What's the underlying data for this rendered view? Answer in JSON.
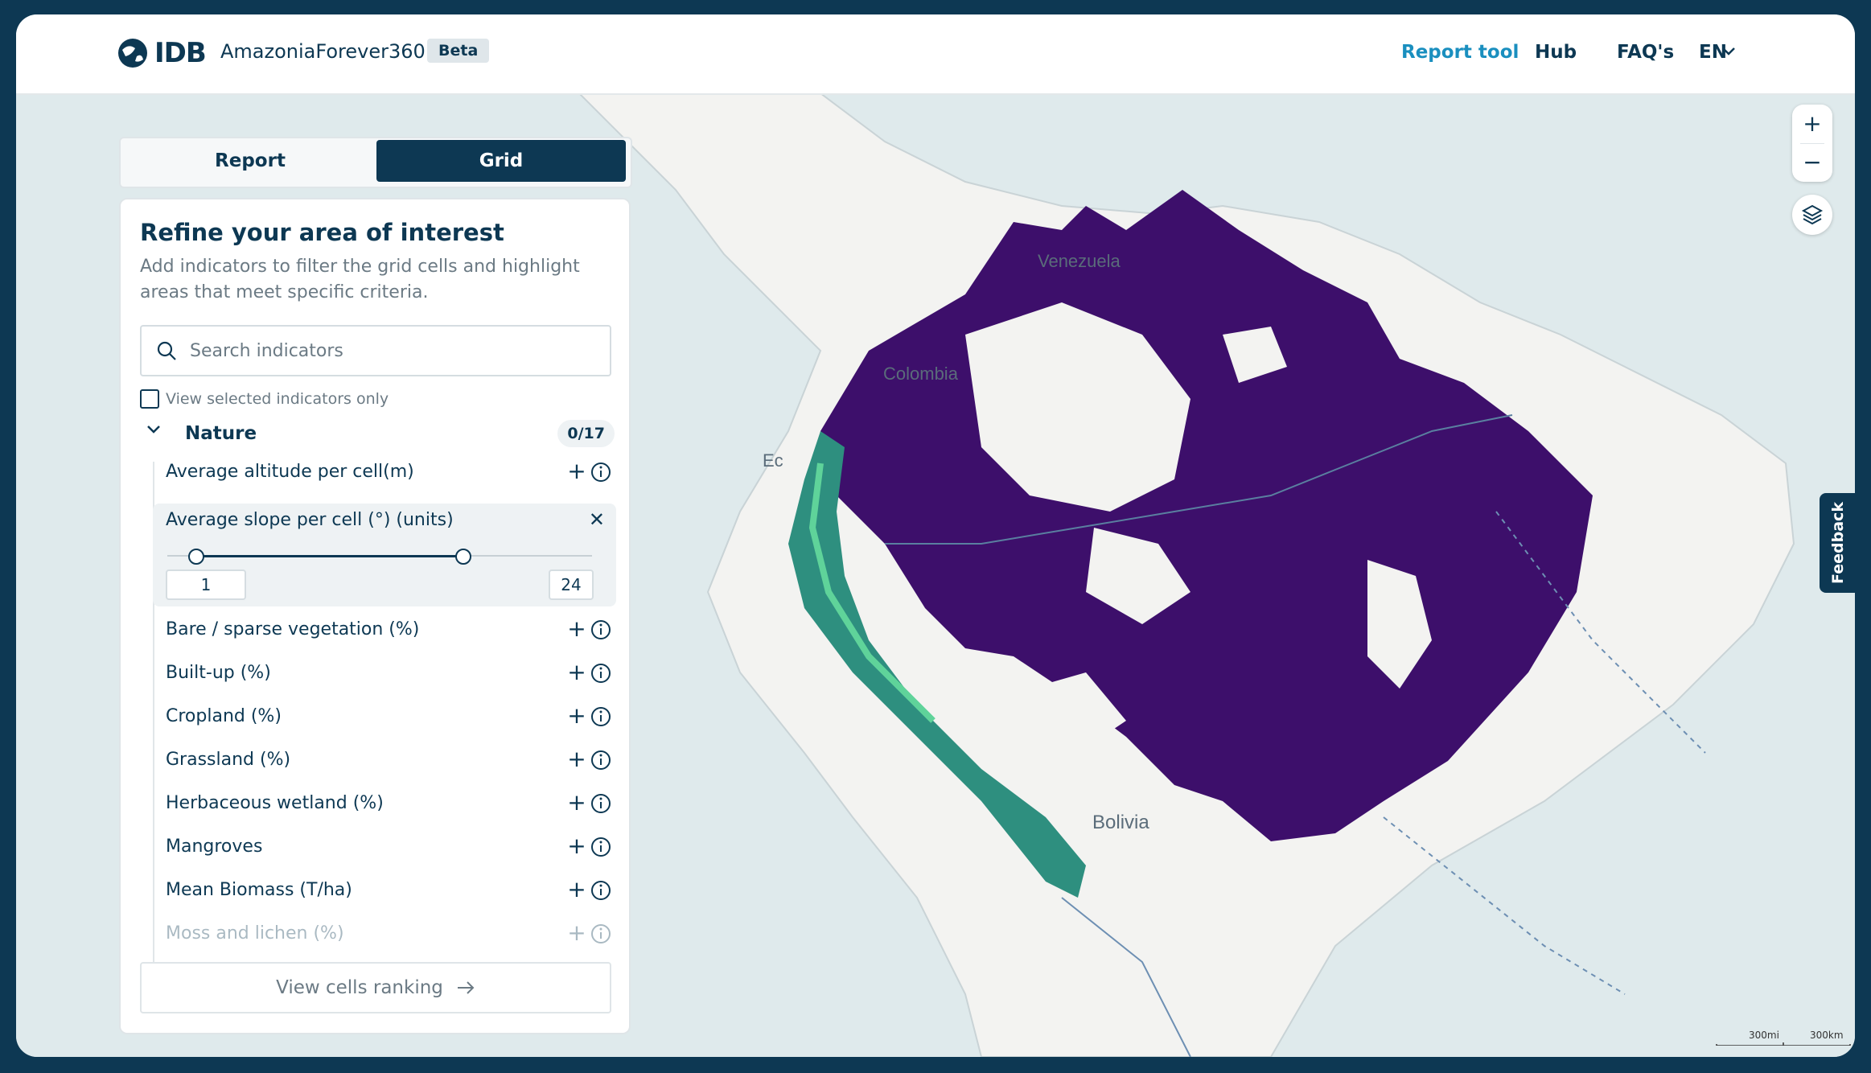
{
  "header": {
    "logo_text": "IDB",
    "app_name": "AmazoniaForever360+",
    "beta_badge": "Beta",
    "nav": [
      {
        "label": "Report tool",
        "active": true
      },
      {
        "label": "Hub",
        "active": false
      },
      {
        "label": "FAQ's",
        "active": false
      }
    ],
    "language": "EN"
  },
  "tabs": [
    {
      "label": "Report",
      "selected": false
    },
    {
      "label": "Grid",
      "selected": true
    }
  ],
  "panel": {
    "title": "Refine your area of interest",
    "description": "Add indicators to filter the grid cells and highlight areas that meet specific criteria.",
    "search_placeholder": "Search indicators",
    "filter_checkbox_label": "View selected indicators only",
    "section": {
      "label": "Nature",
      "count": "0/17",
      "expanded": true
    },
    "indicators": [
      {
        "label": "Average altitude per cell(m)"
      },
      {
        "label": "Bare / sparse vegetation (%)"
      },
      {
        "label": "Built-up (%)"
      },
      {
        "label": "Cropland (%)"
      },
      {
        "label": "Grassland (%)"
      },
      {
        "label": "Herbaceous wetland (%)"
      },
      {
        "label": "Mangroves"
      },
      {
        "label": "Mean Biomass (T/ha)"
      },
      {
        "label": "Moss and lichen (%)"
      }
    ],
    "active_filter": {
      "label": "Average slope per cell (°) (units)",
      "min_value": "1",
      "max_value": "24"
    },
    "cta_label": "View cells ranking"
  },
  "map": {
    "country_labels": [
      "Venezuela",
      "Colombia",
      "Ec",
      "Bolivia"
    ],
    "scale_labels": [
      "300mi",
      "300km"
    ],
    "feedback_label": "Feedback",
    "colors": {
      "data_fill": "#3d0f6b",
      "high_value": "#3dbf8c",
      "ocean": "#dfeaec",
      "land": "#f3f3f1"
    }
  }
}
